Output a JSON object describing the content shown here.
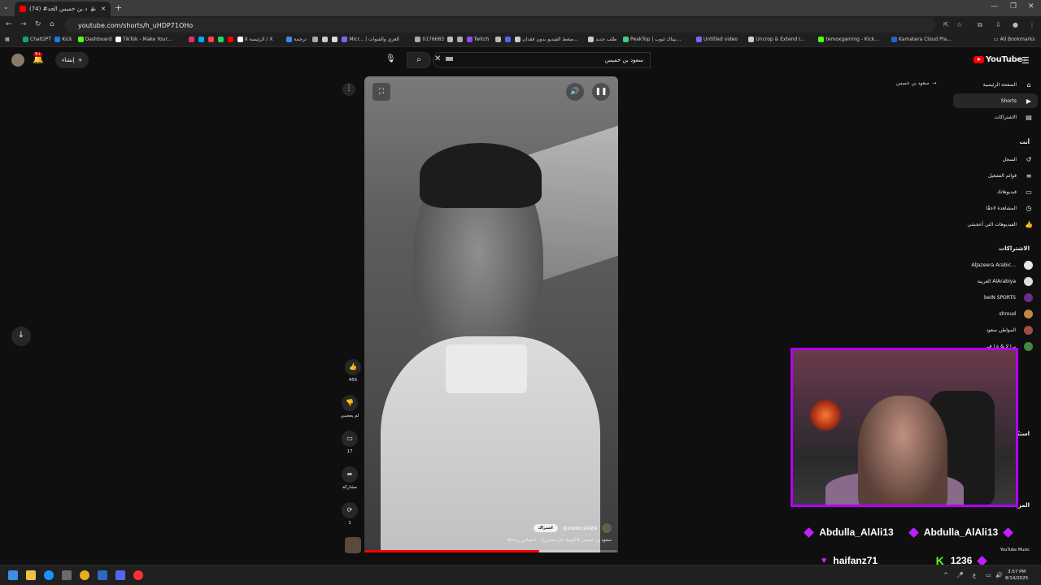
{
  "browser": {
    "tab_title": "(74) #سعود بن خميس الجد...",
    "url": "youtube.com/shorts/h_uHDP71OHo",
    "bookmarks": [
      {
        "label": "ChatGPT",
        "color": "#10a37f"
      },
      {
        "label": "Kick",
        "color": "#1877f2"
      },
      {
        "label": "Dashboard",
        "color": "#53fc18"
      },
      {
        "label": "TikTok - Make Your...",
        "color": "#ffffff"
      },
      {
        "label": "",
        "color": "#e1306c"
      },
      {
        "label": "",
        "color": "#00aaff"
      },
      {
        "label": "",
        "color": "#ff4444"
      },
      {
        "label": "",
        "color": "#25d366"
      },
      {
        "label": "",
        "color": "#ff0000"
      },
      {
        "label": "X الرئيسة / X",
        "color": "#ffffff"
      },
      {
        "label": "ترجمة",
        "color": "#4285f4"
      },
      {
        "label": "",
        "color": "#aaaaaa"
      },
      {
        "label": "",
        "color": "#cccccc"
      },
      {
        "label": "",
        "color": "#dddddd"
      },
      {
        "label": "Micr... | العزي والقنوات",
        "color": "#7b68ee"
      },
      {
        "label": "0176683",
        "color": "#aaaaaa"
      },
      {
        "label": "",
        "color": "#bbbbbb"
      },
      {
        "label": "",
        "color": "#aaaaaa"
      },
      {
        "label": "Twitch",
        "color": "#9146ff"
      },
      {
        "label": "",
        "color": "#bbbbbb"
      },
      {
        "label": "",
        "color": "#5865f2"
      },
      {
        "label": "ضغط الفيديو بدون فقدان...",
        "color": "#cccccc"
      },
      {
        "label": "طلب جديد",
        "color": "#cccccc"
      },
      {
        "label": "PeakTop | بيتاك لبوب...",
        "color": "#44cc88"
      },
      {
        "label": "Untitled video",
        "color": "#7b68ee"
      },
      {
        "label": "Uncrop & Extend I...",
        "color": "#cccccc"
      },
      {
        "label": "temoxgaming - Kick...",
        "color": "#53fc18"
      },
      {
        "label": "Kamatera Cloud Pla...",
        "color": "#2266cc"
      }
    ],
    "all_bookmarks": "All Bookmarks"
  },
  "header": {
    "create_label": "إنشاء",
    "notif_count": "9+",
    "search_value": "سعود بن خميس",
    "logo_text": "YouTube",
    "logo_region": "JO"
  },
  "suggestion": "سعود بن خميس",
  "sidebar": {
    "main": [
      {
        "label": "الصفحة الرئيسية",
        "icon": "home-icon",
        "glyph": "⌂"
      },
      {
        "label": "Shorts",
        "icon": "shorts-icon",
        "glyph": "▶"
      },
      {
        "label": "الاشتراكات",
        "icon": "subscriptions-icon",
        "glyph": "▤"
      }
    ],
    "you_heading": "أنت",
    "you": [
      {
        "label": "السجل",
        "icon": "history-icon",
        "glyph": "↺"
      },
      {
        "label": "قوائم التشغيل",
        "icon": "playlists-icon",
        "glyph": "≡"
      },
      {
        "label": "فيديوهاتك",
        "icon": "your-videos-icon",
        "glyph": "▭"
      },
      {
        "label": "المشاهدة لاحقًا",
        "icon": "watch-later-icon",
        "glyph": "◷"
      },
      {
        "label": "الفيديوهات التي أعجبتني",
        "icon": "liked-icon",
        "glyph": "👍"
      }
    ],
    "subs_heading": "الاشتراكات",
    "subs": [
      {
        "label": "AlJazeera Arabic...",
        "color": "#e8e8e8"
      },
      {
        "label": "العربية AlArabiya",
        "color": "#dddddd"
      },
      {
        "label": "beIN SPORTS",
        "color": "#6a2b8a"
      },
      {
        "label": "shroud",
        "color": "#c08a40"
      },
      {
        "label": "المواطن سعود",
        "color": "#a05040"
      },
      {
        "label": "بـ ا لا & ة ا ف",
        "color": "#448844"
      }
    ],
    "explore_heading": "استكشاف",
    "more_heading": "المزيد",
    "yt_music": "YouTube Music"
  },
  "video": {
    "channel": "@comic2424",
    "subscribe": "اشتراك",
    "title": "#سعود بن خميس #كوميك في مشروع... احساس روعة",
    "progress": 0.69
  },
  "actions": {
    "likes": "455",
    "dislike": "لم يعجبني",
    "comments": "17",
    "share": "مشاركة",
    "remix": "1"
  },
  "overlay": {
    "row1_left": "Abdulla_AlAli13",
    "row1_right": "Abdulla_AlAli13",
    "row2_left": "haifanz71",
    "row2_right": "1236"
  },
  "taskbar": {
    "time": "3:57 PM",
    "date": "8/14/2025",
    "lang": "ع"
  }
}
